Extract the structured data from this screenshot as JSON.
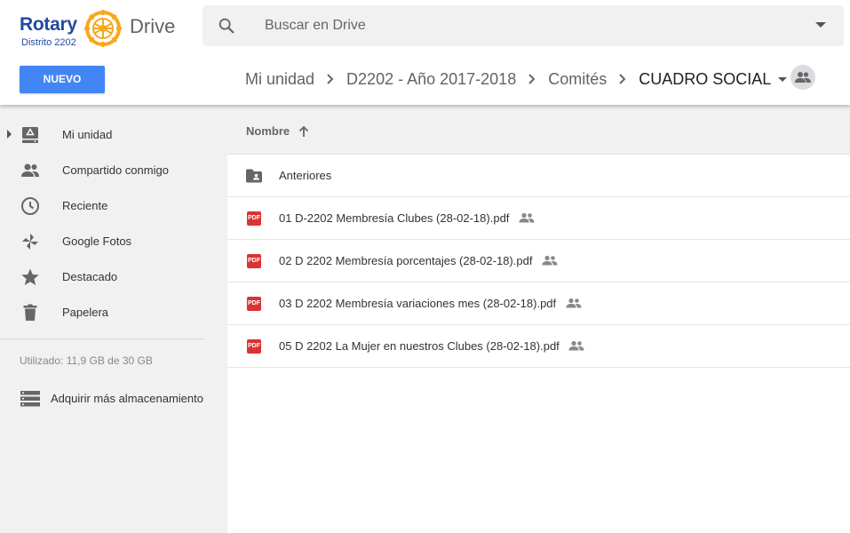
{
  "brand": {
    "logo_name": "Rotary",
    "logo_district": "Distrito 2202",
    "app_name": "Drive"
  },
  "search": {
    "placeholder": "Buscar en Drive"
  },
  "toolbar": {
    "new_label": "NUEVO"
  },
  "breadcrumb": {
    "items": [
      "Mi unidad",
      "D2202 - Año 2017-2018",
      "Comités",
      "CUADRO SOCIAL"
    ]
  },
  "sidebar": {
    "items": [
      {
        "label": "Mi unidad",
        "icon": "drive-icon"
      },
      {
        "label": "Compartido conmigo",
        "icon": "people-icon"
      },
      {
        "label": "Reciente",
        "icon": "clock-icon"
      },
      {
        "label": "Google Fotos",
        "icon": "pinwheel-icon"
      },
      {
        "label": "Destacado",
        "icon": "star-icon"
      },
      {
        "label": "Papelera",
        "icon": "trash-icon"
      }
    ],
    "storage_text": "Utilizado: 11,9 GB de 30 GB",
    "buy_storage_label": "Adquirir más almacenamiento"
  },
  "list": {
    "column_name": "Nombre",
    "rows": [
      {
        "name": "Anteriores",
        "type": "shared-folder",
        "shared": false
      },
      {
        "name": "01 D-2202 Membresía Clubes (28-02-18).pdf",
        "type": "pdf",
        "shared": true
      },
      {
        "name": "02 D 2202 Membresía porcentajes (28-02-18).pdf",
        "type": "pdf",
        "shared": true
      },
      {
        "name": "03 D 2202 Membresía variaciones mes (28-02-18).pdf",
        "type": "pdf",
        "shared": true
      },
      {
        "name": "05 D 2202 La Mujer en nuestros Clubes (28-02-18).pdf",
        "type": "pdf",
        "shared": true
      }
    ],
    "pdf_badge": "PDF"
  },
  "colors": {
    "accent": "#4285f4",
    "pdf_red": "#db3236",
    "rotary_blue": "#1f4aa3",
    "rotary_gold": "#f7a81b"
  }
}
